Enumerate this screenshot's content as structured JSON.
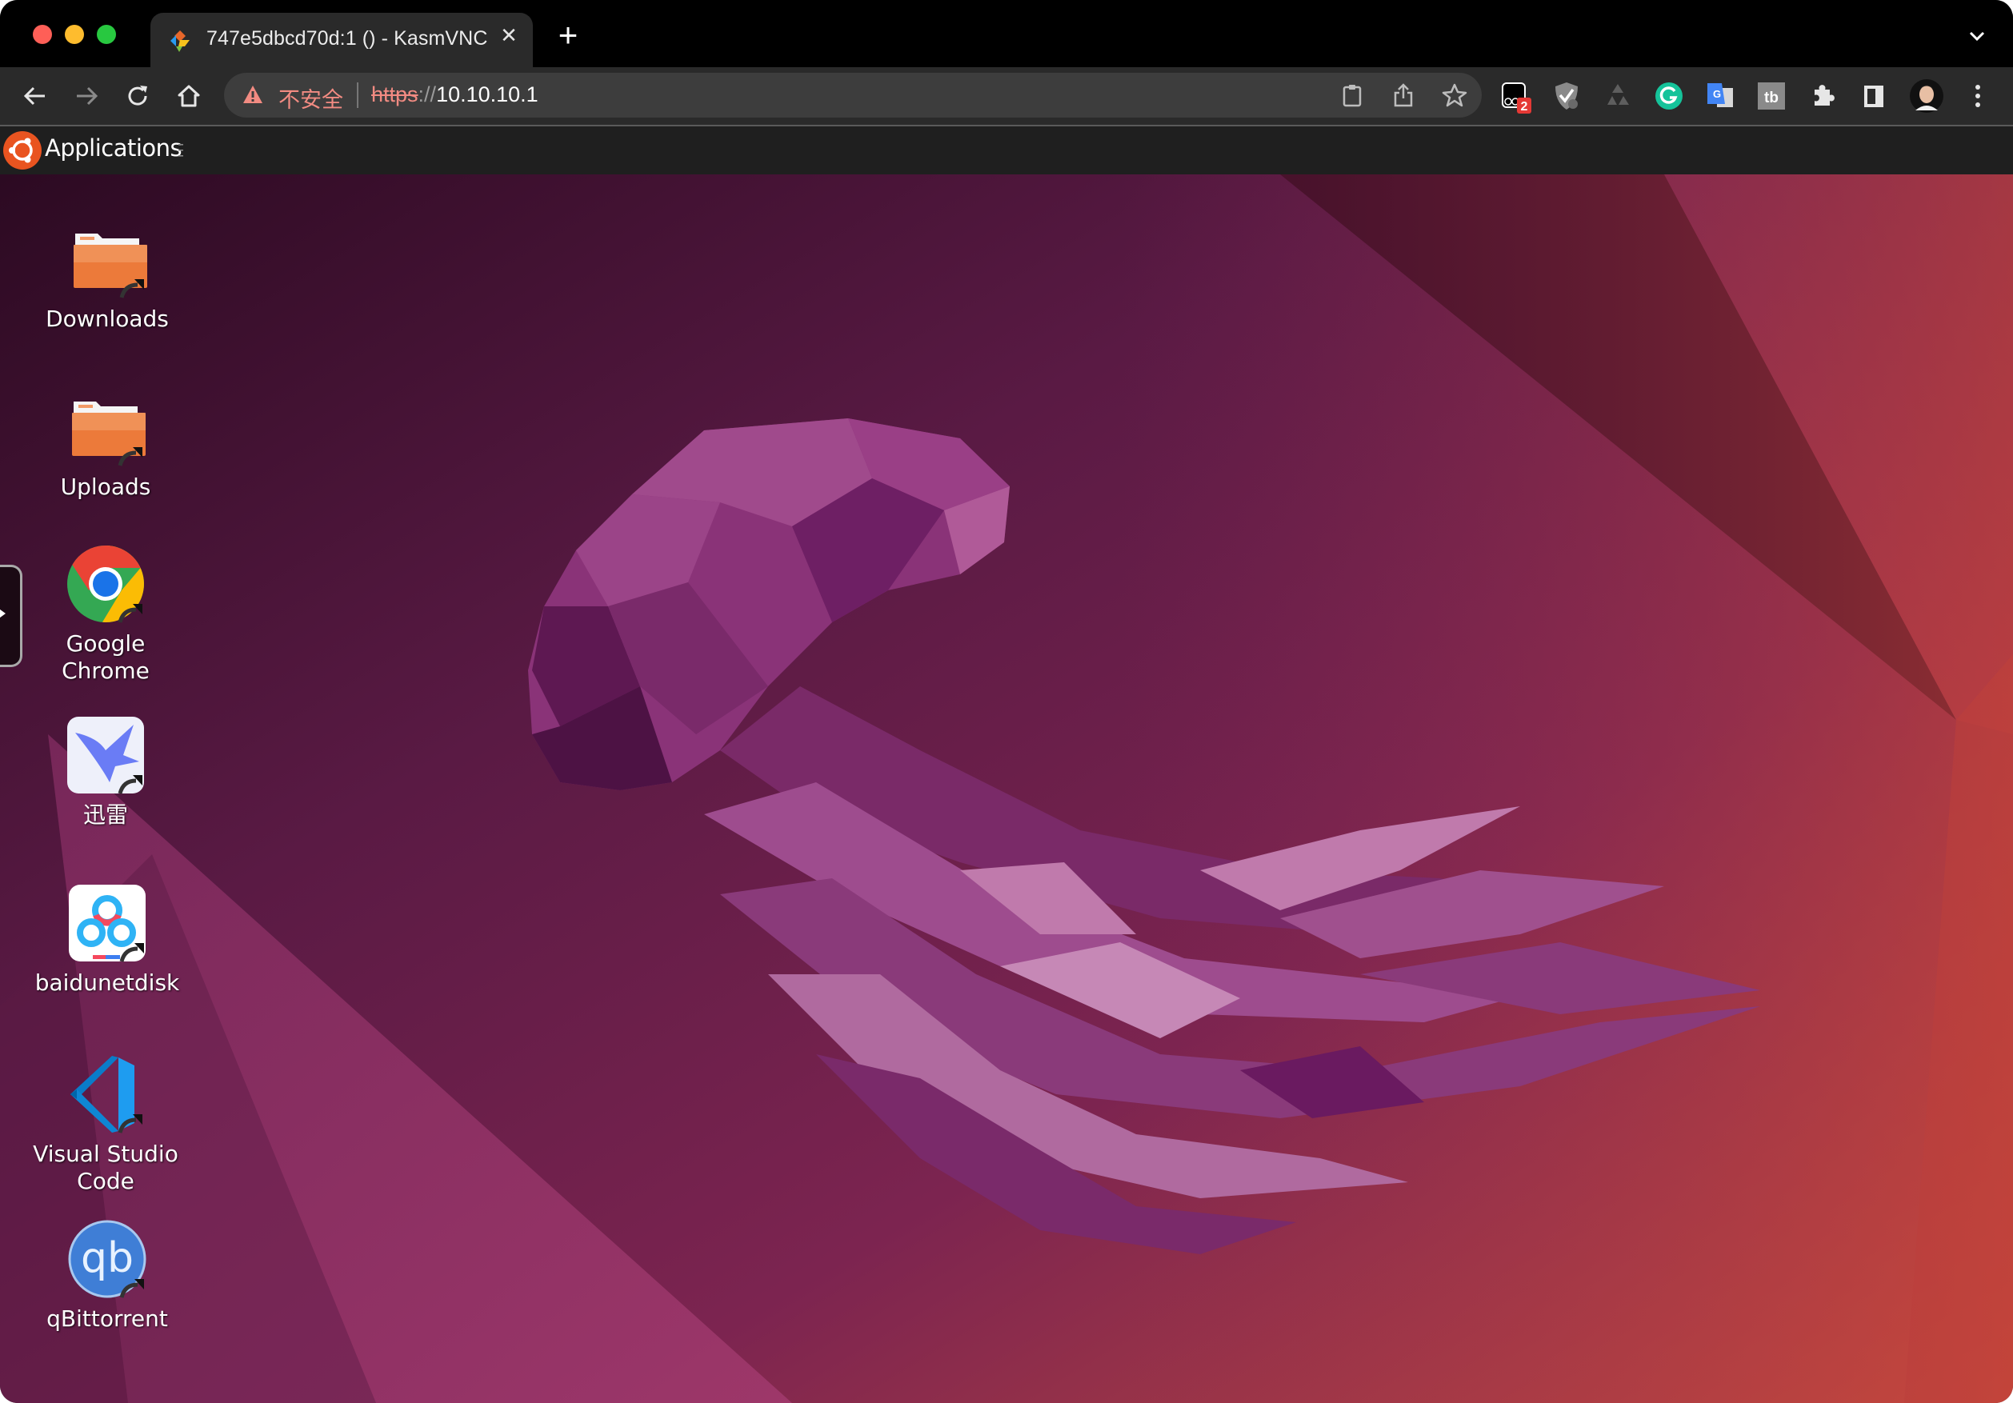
{
  "window_controls": {
    "close": "close-window",
    "minimize": "minimize-window",
    "maximize": "maximize-window"
  },
  "tab": {
    "title": "747e5dbcd70d:1 () - KasmVNC",
    "close_glyph": "✕",
    "favicon": "kasmvnc-icon"
  },
  "new_tab_glyph": "+",
  "tab_list_icon": "chevron-down-icon",
  "toolbar": {
    "back": "back-arrow-icon",
    "forward": "forward-arrow-icon",
    "reload": "reload-icon",
    "home": "home-icon"
  },
  "address_bar": {
    "security_label": "不安全",
    "url_scheme": "https",
    "url_separator": "://",
    "url_host": "10.10.10.1",
    "actions": [
      "clipboard-icon",
      "share-icon",
      "bookmark-star-icon"
    ]
  },
  "extensions": [
    {
      "name": "extension-badge-icon",
      "badge": "2"
    },
    {
      "name": "adguard-shield-icon"
    },
    {
      "name": "recycle-icon"
    },
    {
      "name": "grammarly-icon"
    },
    {
      "name": "google-translate-icon"
    },
    {
      "name": "tb-extension-icon"
    },
    {
      "name": "extensions-puzzle-icon"
    },
    {
      "name": "side-panel-icon"
    },
    {
      "name": "profile-avatar"
    },
    {
      "name": "more-menu-icon"
    }
  ],
  "kasm_panel": {
    "applications_label": "Applications"
  },
  "desktop_icons": [
    {
      "label": "Downloads",
      "icon": "folder-icon"
    },
    {
      "label": "Uploads",
      "icon": "folder-icon"
    },
    {
      "label": "Google\nChrome",
      "label_line1": "Google",
      "label_line2": "Chrome",
      "icon": "chrome-icon"
    },
    {
      "label": "迅雷",
      "icon": "xunlei-icon"
    },
    {
      "label": "baidunetdisk",
      "icon": "baidunetdisk-icon"
    },
    {
      "label_line1": "Visual Studio",
      "label_line2": "Code",
      "icon": "vscode-icon"
    },
    {
      "label": "qBittorrent",
      "icon": "qbittorrent-icon"
    }
  ],
  "colors": {
    "ubuntu_orange": "#e95420",
    "not_secure_red": "#f28b82",
    "wallpaper_dark": "#2c0a22",
    "wallpaper_mid": "#6e1f4e",
    "wallpaper_warm": "#c84a3e"
  }
}
